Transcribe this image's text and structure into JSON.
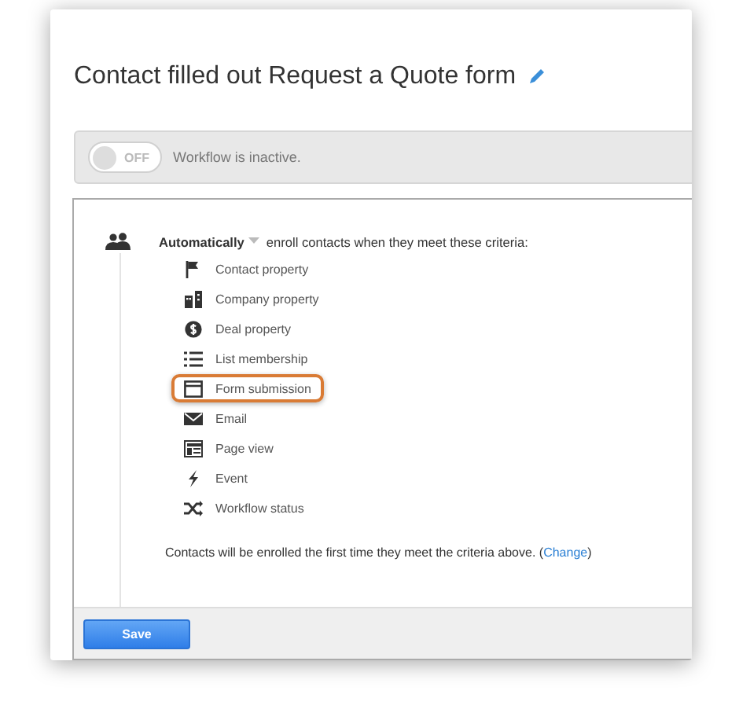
{
  "title": "Contact filled out Request a Quote form",
  "workflow": {
    "on": false,
    "toggle_label": "OFF",
    "status": "Workflow is inactive."
  },
  "enrollment": {
    "mode": "Automatically",
    "criteria_text": "enroll contacts when they meet these criteria:",
    "criteria": [
      {
        "kind": "flag",
        "label": "Contact property",
        "selected": false
      },
      {
        "kind": "building",
        "label": "Company property",
        "selected": false
      },
      {
        "kind": "dollar",
        "label": "Deal property",
        "selected": false
      },
      {
        "kind": "list",
        "label": "List membership",
        "selected": false
      },
      {
        "kind": "form",
        "label": "Form submission",
        "selected": true
      },
      {
        "kind": "envelope",
        "label": "Email",
        "selected": false
      },
      {
        "kind": "page",
        "label": "Page view",
        "selected": false
      },
      {
        "kind": "bolt",
        "label": "Event",
        "selected": false
      },
      {
        "kind": "shuffle",
        "label": "Workflow status",
        "selected": false
      }
    ],
    "note": "Contacts will be enrolled the first time they meet the criteria above. (",
    "note_link": "Change",
    "note_end": ")"
  },
  "buttons": [
    "Save"
  ]
}
